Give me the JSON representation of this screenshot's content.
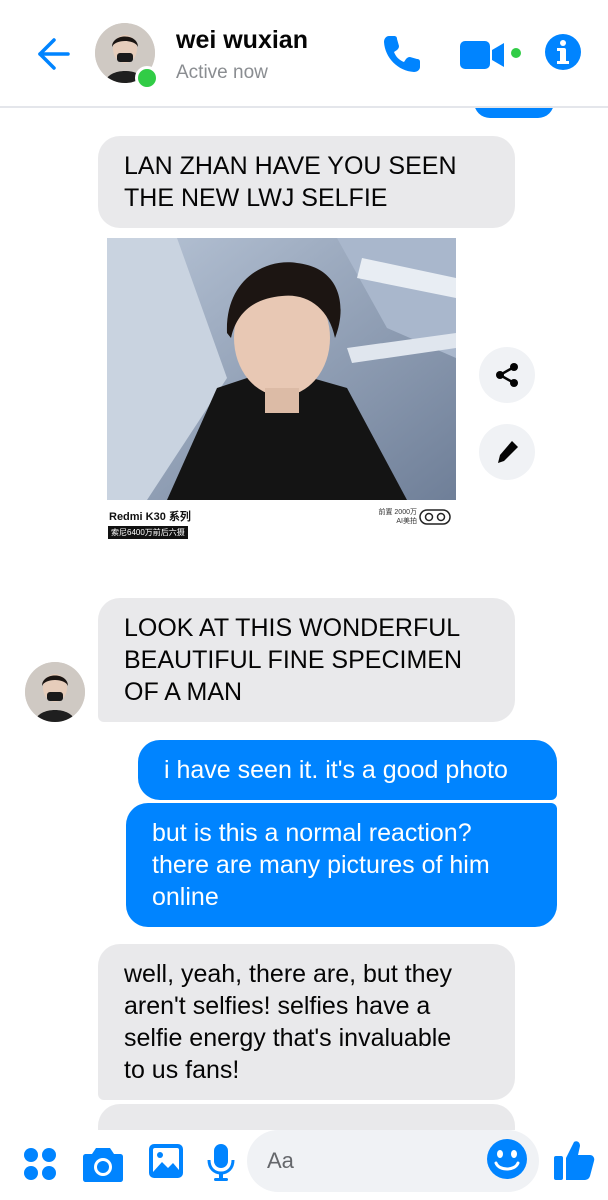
{
  "header": {
    "contact_name": "wei wuxian",
    "status": "Active now",
    "accent_color": "#0084ff",
    "active_color": "#31cc46",
    "icons": [
      "back-arrow-icon",
      "phone-icon",
      "video-camera-icon",
      "info-icon"
    ]
  },
  "messages": [
    {
      "from": "contact",
      "text": "LAN ZHAN HAVE YOU SEEN\nTHE NEW LWJ SELFIE"
    },
    {
      "from": "contact",
      "type": "photo",
      "caption_brand": "Redmi K30 系列",
      "caption_sub": "索尼6400万前后六摄",
      "caption_spec": "前置 2000万\nAI美拍"
    },
    {
      "from": "contact",
      "text": "LOOK AT THIS WONDERFUL\nBEAUTIFUL FINE SPECIMEN\nOF A MAN"
    },
    {
      "from": "me",
      "text": "i have seen it. it's a good photo"
    },
    {
      "from": "me",
      "text": "but is this a normal reaction?\nthere are many pictures of him\nonline"
    },
    {
      "from": "contact",
      "text": "well, yeah, there are, but they\naren't selfies! selfies have a\nselfie energy that's invaluable\nto us fans!"
    }
  ],
  "photo_actions": [
    "share-icon",
    "edit-pencil-icon"
  ],
  "composer": {
    "placeholder": "Aa",
    "icons": [
      "apps-icon",
      "camera-icon",
      "gallery-icon",
      "microphone-icon",
      "emoji-icon",
      "thumbs-up-icon"
    ]
  },
  "colors": {
    "received_bubble": "#e9e9eb",
    "sent_bubble": "#0084ff"
  }
}
